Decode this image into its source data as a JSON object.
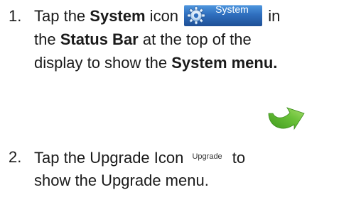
{
  "step1": {
    "number": "1.",
    "lines": [
      {
        "before": "Tap the ",
        "bold": "System",
        "after": " icon"
      },
      {
        "after_icon": " in"
      }
    ],
    "icon_label": "System",
    "line2": {
      "before": "the ",
      "bold": "Status Bar",
      "after": " at the top of the"
    },
    "line3": {
      "before": "display to show the ",
      "bold": "System menu."
    }
  },
  "step2": {
    "number": "2.",
    "line1_before": "Tap the Upgrade Icon ",
    "icon_text": "Upgrade",
    "line1_after": " to",
    "line2": "show the Upgrade menu."
  },
  "icons": {
    "system_icon": "gear-icon",
    "upgrade_icon": "upgrade-arrow-icon"
  },
  "colors": {
    "system_icon_bg": "#2f6fbe",
    "arrow_green": "#5fb02c"
  }
}
